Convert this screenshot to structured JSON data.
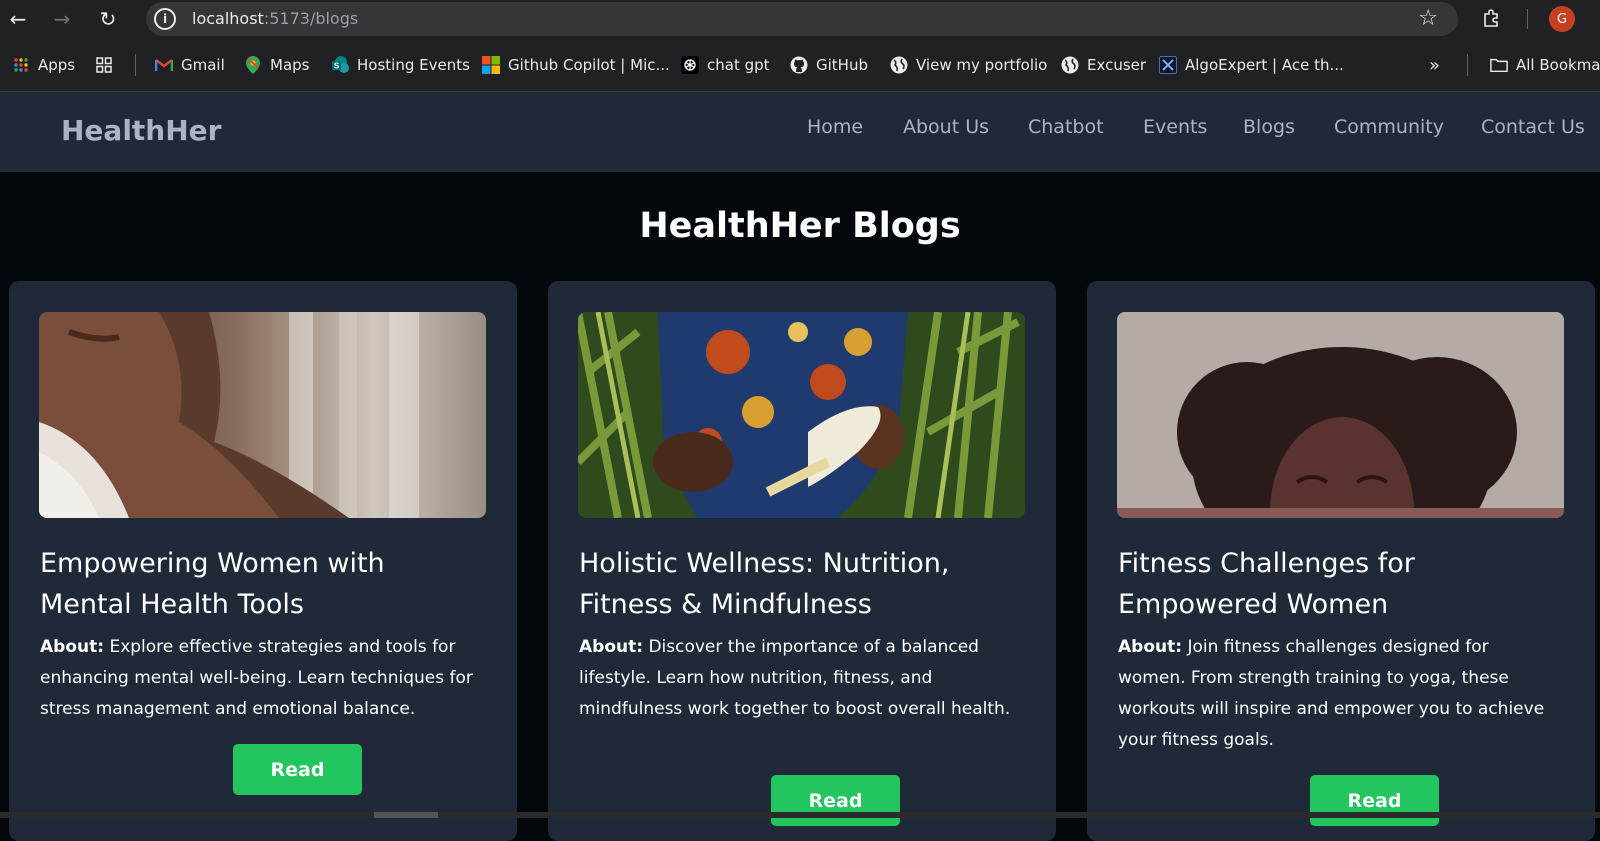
{
  "browser": {
    "url_host": "localhost",
    "url_rest": ":5173/blogs",
    "profile_initial": "G"
  },
  "bookmarks": [
    {
      "label": "Apps",
      "icon": "apps-grid-icon"
    },
    {
      "label": "",
      "icon": "tab-groups-icon"
    },
    {
      "label": "Gmail",
      "icon": "gmail-icon"
    },
    {
      "label": "Maps",
      "icon": "maps-icon"
    },
    {
      "label": "Hosting Events",
      "icon": "sharepoint-icon"
    },
    {
      "label": "Github Copilot | Mic...",
      "icon": "microsoft-icon"
    },
    {
      "label": "chat gpt",
      "icon": "chatgpt-icon"
    },
    {
      "label": "GitHub",
      "icon": "github-icon"
    },
    {
      "label": "View my portfolio",
      "icon": "globe-icon"
    },
    {
      "label": "Excuser",
      "icon": "globe-icon"
    },
    {
      "label": "AlgoExpert | Ace th...",
      "icon": "algoexpert-icon"
    }
  ],
  "all_bookmarks": "All Bookmarks",
  "site": {
    "brand": "HealthHer",
    "nav": [
      "Home",
      "About Us",
      "Chatbot",
      "Events",
      "Blogs",
      "Community",
      "Contact Us"
    ]
  },
  "page_title": "HealthHer Blogs",
  "blogs": [
    {
      "title": "Empowering Women with Mental Health Tools",
      "about_label": "About:",
      "about": "Explore effective strategies and tools for enhancing mental well-being. Learn techniques for stress management and emotional balance.",
      "button": "Read"
    },
    {
      "title": "Holistic Wellness: Nutrition, Fitness & Mindfulness",
      "about_label": "About:",
      "about": "Discover the importance of a balanced lifestyle. Learn how nutrition, fitness, and mindfulness work together to boost overall health.",
      "button": "Read"
    },
    {
      "title": "Fitness Challenges for Empowered Women",
      "about_label": "About:",
      "about": "Join fitness challenges designed for women. From strength training to yoga, these workouts will inspire and empower you to achieve your fitness goals.",
      "button": "Read"
    }
  ],
  "colors": {
    "header_bg": "#1f2937",
    "page_bg": "#03080d",
    "card_bg": "#1f2937",
    "button_green": "#22c55e"
  }
}
